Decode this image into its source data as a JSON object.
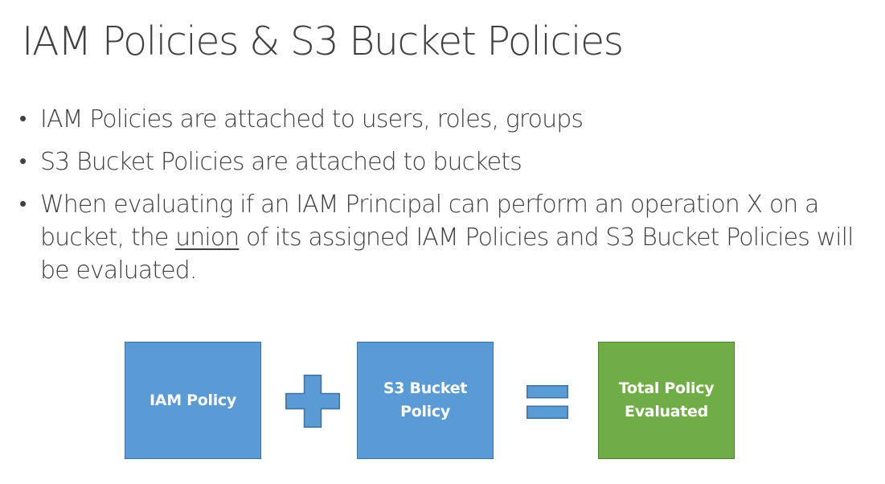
{
  "slide": {
    "title": "IAM Policies & S3 Bucket Policies",
    "bullets": [
      {
        "text": "IAM Policies are attached to users, roles, groups"
      },
      {
        "text": "S3 Bucket Policies are attached to buckets"
      },
      {
        "text_before": "When evaluating if an IAM Principal can perform an operation X on a bucket, the ",
        "underlined": "union",
        "text_after": " of its assigned IAM Policies and S3 Bucket Policies will be evaluated."
      }
    ],
    "bullet_glyph": "•"
  },
  "diagram": {
    "boxes": [
      {
        "label": "IAM Policy",
        "color": "#5b9bd5"
      },
      {
        "label": "S3 Bucket Policy",
        "color": "#5b9bd5"
      },
      {
        "label": "Total Policy Evaluated",
        "color": "#70ad47"
      }
    ],
    "operators": [
      {
        "icon": "plus-icon",
        "color": "#5b9bd5"
      },
      {
        "icon": "equals-icon",
        "color": "#5b9bd5"
      }
    ]
  }
}
